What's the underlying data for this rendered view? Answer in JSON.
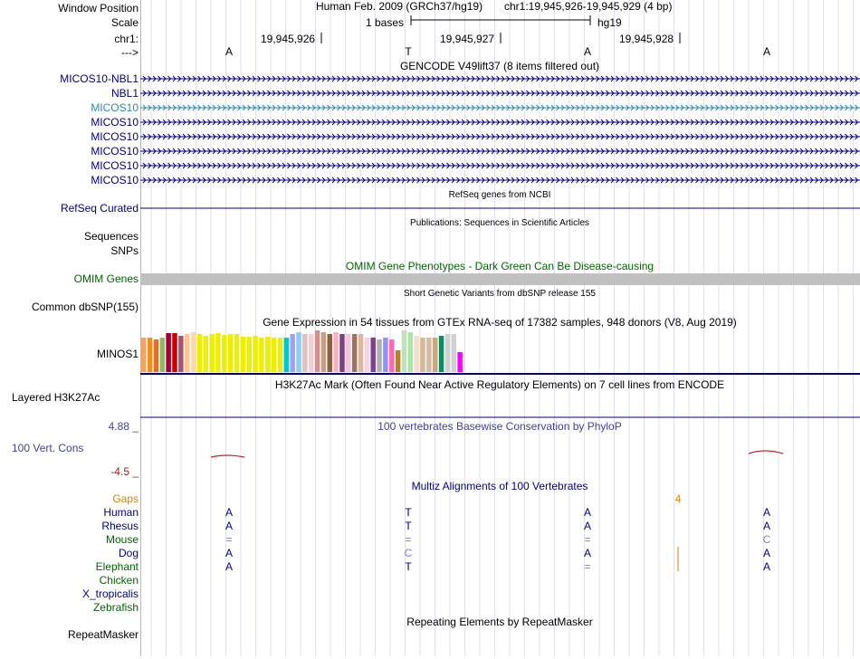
{
  "header": {
    "window_position_label": "Window Position",
    "scale_label": "Scale",
    "chrom_label": "chr1:",
    "strand_label": "--->",
    "assembly": "Human Feb. 2009 (GRCh37/hg19)",
    "position": "chr1:19,945,926-19,945,929 (4 bp)",
    "scale_value": "1 bases",
    "db": "hg19",
    "ticks": [
      "19,945,926",
      "19,945,927",
      "19,945,928"
    ],
    "bases": [
      "A",
      "T",
      "A",
      "A"
    ]
  },
  "gencode": {
    "title": "GENCODE V49lift37 (8 items filtered out)",
    "items": [
      "MICOS10-NBL1",
      "NBL1",
      "MICOS10",
      "MICOS10",
      "MICOS10",
      "MICOS10",
      "MICOS10",
      "MICOS10"
    ],
    "highlight_color": "#2a8aa8",
    "color": "#000080"
  },
  "refseq": {
    "title": "RefSeq genes from NCBI",
    "label": "RefSeq Curated"
  },
  "publications": {
    "title": "Publications: Sequences in Scientific Articles",
    "label": "Sequences"
  },
  "snps": {
    "label": "SNPs"
  },
  "omim": {
    "title": "OMIM Gene Phenotypes - Dark Green Can Be Disease-causing",
    "label": "OMIM Genes",
    "color": "#006400"
  },
  "dbsnp": {
    "title": "Short Genetic Variants from dbSNP release 155",
    "label": "Common dbSNP(155)"
  },
  "gtex": {
    "title": "Gene Expression in 54 tissues from GTEx RNA-seq of 17382 samples, 948 donors (V8, Aug 2019)",
    "label": "MINOS1",
    "bars": [
      {
        "c": "#f4a460",
        "h": 38
      },
      {
        "c": "#ff8c00",
        "h": 38
      },
      {
        "c": "#e07030",
        "h": 36
      },
      {
        "c": "#8fbc5a",
        "h": 38
      },
      {
        "c": "#a00030",
        "h": 43
      },
      {
        "c": "#cc0000",
        "h": 43
      },
      {
        "c": "#b05070",
        "h": 40
      },
      {
        "c": "#ffc890",
        "h": 42
      },
      {
        "c": "#ffd8a8",
        "h": 44
      },
      {
        "c": "#eeee00",
        "h": 42
      },
      {
        "c": "#eeee00",
        "h": 40
      },
      {
        "c": "#eeee00",
        "h": 42
      },
      {
        "c": "#eeee00",
        "h": 43
      },
      {
        "c": "#eeee00",
        "h": 41
      },
      {
        "c": "#eeee00",
        "h": 42
      },
      {
        "c": "#eeee00",
        "h": 42
      },
      {
        "c": "#eeee00",
        "h": 39
      },
      {
        "c": "#eeee00",
        "h": 39
      },
      {
        "c": "#eeee00",
        "h": 40
      },
      {
        "c": "#eeee00",
        "h": 38
      },
      {
        "c": "#eeee00",
        "h": 39
      },
      {
        "c": "#eeee00",
        "h": 38
      },
      {
        "c": "#eeee00",
        "h": 38
      },
      {
        "c": "#00c8c8",
        "h": 38
      },
      {
        "c": "#a0a0ff",
        "h": 42
      },
      {
        "c": "#87cefa",
        "h": 44
      },
      {
        "c": "#e0c0c0",
        "h": 42
      },
      {
        "c": "#f0d0d0",
        "h": 42
      },
      {
        "c": "#d09090",
        "h": 46
      },
      {
        "c": "#c8a080",
        "h": 44
      },
      {
        "c": "#8b6040",
        "h": 42
      },
      {
        "c": "#ffb0c0",
        "h": 44
      },
      {
        "c": "#804080",
        "h": 42
      },
      {
        "c": "#f0c8d8",
        "h": 42
      },
      {
        "c": "#a07060",
        "h": 42
      },
      {
        "c": "#d8b8a0",
        "h": 42
      },
      {
        "c": "#ffd0e0",
        "h": 38
      },
      {
        "c": "#804090",
        "h": 38
      },
      {
        "c": "#b0b0b0",
        "h": 36
      },
      {
        "c": "#9090ff",
        "h": 38
      },
      {
        "c": "#ff69b4",
        "h": 36
      },
      {
        "c": "#b88020",
        "h": 24
      },
      {
        "c": "#c0e0c0",
        "h": 46
      },
      {
        "c": "#a8e8a0",
        "h": 44
      },
      {
        "c": "#f0e0d0",
        "h": 40
      },
      {
        "c": "#d8b890",
        "h": 38
      },
      {
        "c": "#d8b8a0",
        "h": 38
      },
      {
        "c": "#c8a880",
        "h": 38
      },
      {
        "c": "#009060",
        "h": 40
      },
      {
        "c": "#d0d0d0",
        "h": 42
      },
      {
        "c": "#d0d0d0",
        "h": 42
      },
      {
        "c": "#ff00ff",
        "h": 22
      }
    ]
  },
  "h3k27ac": {
    "title": "H3K27Ac Mark (Often Found Near Active Regulatory Elements) on 7 cell lines from ENCODE",
    "label": "Layered H3K27Ac"
  },
  "phylop": {
    "title": "100 vertebrates Basewise Conservation by PhyloP",
    "label": "100 Vert. Cons",
    "max": "4.88 _",
    "min": "-4.5 _",
    "title_color": "#4040a0",
    "max_color": "#4040a0",
    "min_color": "#a02020"
  },
  "multiz": {
    "title": "Multiz Alignments of 100 Vertebrates",
    "gaps_label": "Gaps",
    "gaps_color": "#e08000",
    "gap_value": "4",
    "species": [
      {
        "name": "Human",
        "color": "#000080",
        "bases": [
          "A",
          "T",
          "A",
          "A"
        ],
        "bc": [
          "#000080",
          "#000080",
          "#000080",
          "#000080"
        ]
      },
      {
        "name": "Rhesus",
        "color": "#000080",
        "bases": [
          "A",
          "T",
          "A",
          "A"
        ],
        "bc": [
          "#000080",
          "#000080",
          "#000080",
          "#000080"
        ]
      },
      {
        "name": "Mouse",
        "color": "#006400",
        "bases": [
          "=",
          "=",
          "=",
          "C"
        ],
        "bc": [
          "#8080c0",
          "#8080c0",
          "#8080c0",
          "#8080c0"
        ]
      },
      {
        "name": "Dog",
        "color": "#000080",
        "bases": [
          "A",
          "C",
          "A",
          "A"
        ],
        "bc": [
          "#000080",
          "#8080c0",
          "#000080",
          "#000080"
        ]
      },
      {
        "name": "Elephant",
        "color": "#006400",
        "bases": [
          "A",
          "T",
          "=",
          "A"
        ],
        "bc": [
          "#000080",
          "#000080",
          "#8080c0",
          "#000080"
        ]
      },
      {
        "name": "Chicken",
        "color": "#006400",
        "bases": [
          "",
          "",
          "",
          ""
        ],
        "bc": [
          "#000080",
          "#000080",
          "#000080",
          "#000080"
        ]
      },
      {
        "name": "X_tropicalis",
        "color": "#000080",
        "bases": [
          "",
          "",
          "",
          ""
        ],
        "bc": [
          "#000080",
          "#000080",
          "#000080",
          "#000080"
        ]
      },
      {
        "name": "Zebrafish",
        "color": "#006400",
        "bases": [
          "",
          "",
          "",
          ""
        ],
        "bc": [
          "#000080",
          "#000080",
          "#000080",
          "#000080"
        ]
      }
    ]
  },
  "repeatmasker": {
    "title": "Repeating Elements by RepeatMasker",
    "label": "RepeatMasker"
  }
}
